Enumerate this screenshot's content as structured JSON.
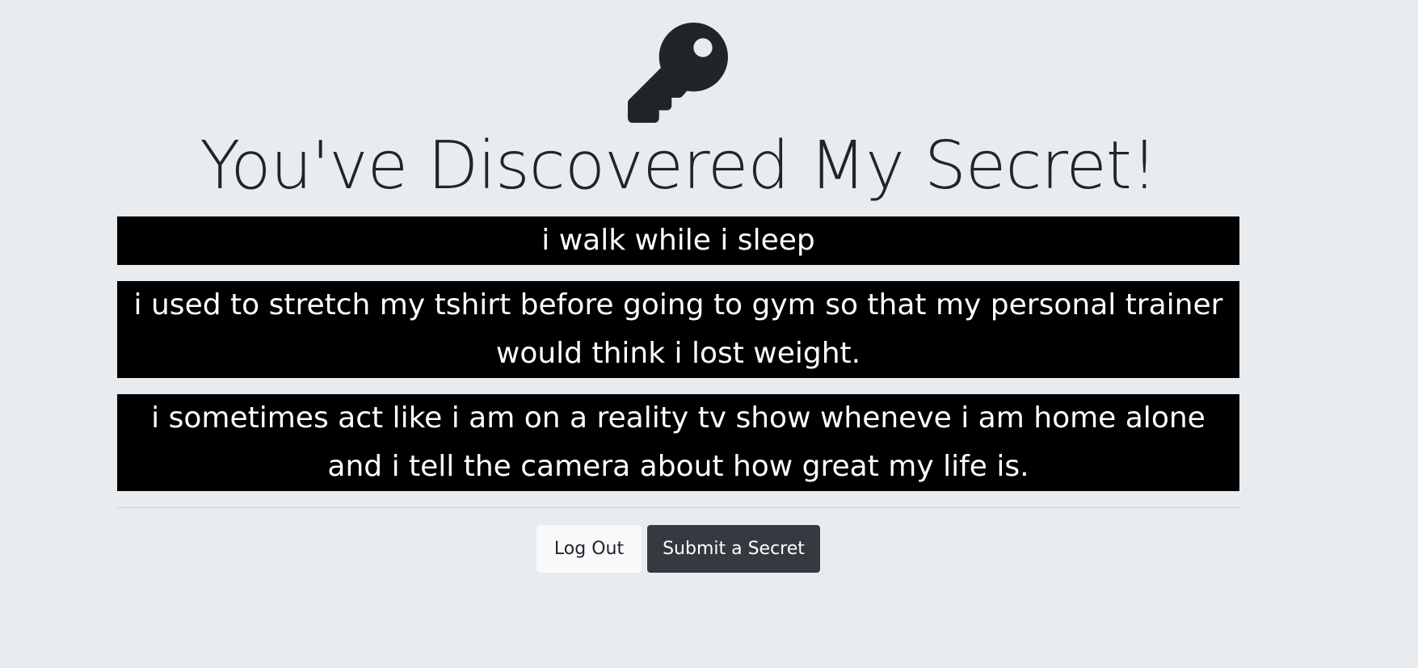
{
  "page": {
    "title": "You've Discovered My Secret!",
    "icon": "key-icon",
    "background_color": "#e9ecef"
  },
  "secrets": [
    {
      "text": "i walk while i sleep"
    },
    {
      "text": "i used to stretch my tshirt before going to gym so that my personal trainer would think i lost weight."
    },
    {
      "text": "i sometimes act like i am on a reality tv show wheneve i am home alone and i tell the camera about how great my life is."
    }
  ],
  "actions": {
    "logout_label": "Log Out",
    "submit_label": "Submit a Secret"
  },
  "colors": {
    "secret_background": "#000000",
    "secret_text": "#ffffff",
    "logout_button": "#f8f9fa",
    "submit_button": "#343a40"
  }
}
